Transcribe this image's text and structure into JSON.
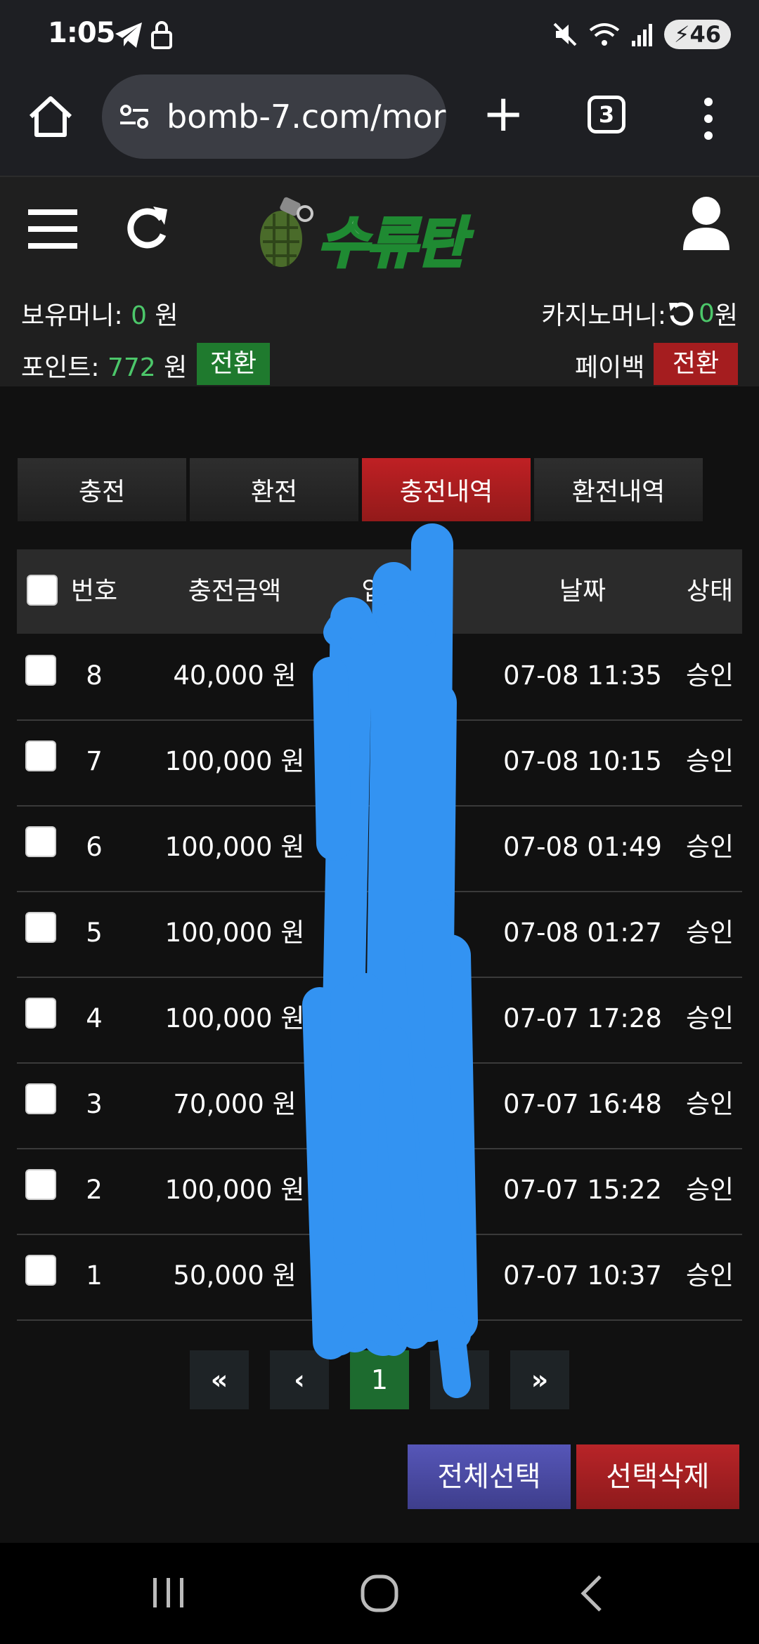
{
  "status_bar": {
    "time": "1:05",
    "battery": "46"
  },
  "browser": {
    "url": "bomb-7.com/mor",
    "tab_count": "3"
  },
  "site": {
    "logo_text": "수류탄",
    "balance_label": "보유머니: ",
    "balance_value": "0",
    "currency": " 원",
    "casino_label": "카지노머니: ",
    "casino_value": "0",
    "points_label": "포인트: ",
    "points_value": "772",
    "convert_label": "전환",
    "payback_label": "페이백",
    "payback_convert_label": "전환"
  },
  "tabs": [
    {
      "label": "충전",
      "active": false
    },
    {
      "label": "환전",
      "active": false
    },
    {
      "label": "충전내역",
      "active": true
    },
    {
      "label": "환전내역",
      "active": false
    }
  ],
  "table": {
    "headers": {
      "no": "번호",
      "amount": "충전금액",
      "depositor": "입금자",
      "date": "날짜",
      "status": "상태"
    },
    "rows": [
      {
        "no": "8",
        "amount": "40,000 원",
        "date": "07-08 11:35",
        "status": "승인"
      },
      {
        "no": "7",
        "amount": "100,000 원",
        "date": "07-08 10:15",
        "status": "승인"
      },
      {
        "no": "6",
        "amount": "100,000 원",
        "date": "07-08 01:49",
        "status": "승인"
      },
      {
        "no": "5",
        "amount": "100,000 원",
        "date": "07-08 01:27",
        "status": "승인"
      },
      {
        "no": "4",
        "amount": "100,000 원",
        "date": "07-07 17:28",
        "status": "승인"
      },
      {
        "no": "3",
        "amount": "70,000 원",
        "date": "07-07 16:48",
        "status": "승인"
      },
      {
        "no": "2",
        "amount": "100,000 원",
        "date": "07-07 15:22",
        "status": "승인"
      },
      {
        "no": "1",
        "amount": "50,000 원",
        "date": "07-07 10:37",
        "status": "승인"
      }
    ]
  },
  "pagination": {
    "first": "«",
    "prev": "‹",
    "current": "1",
    "next": "›",
    "last": "»"
  },
  "actions": {
    "select_all": "전체선택",
    "delete_selected": "선택삭제"
  },
  "colors": {
    "accent_red": "#a51d1f",
    "accent_green": "#1f7a2e",
    "money_green": "#4cc76a",
    "select_all_bg": "#4a4aa0",
    "scribble_blue": "#3393f2"
  }
}
